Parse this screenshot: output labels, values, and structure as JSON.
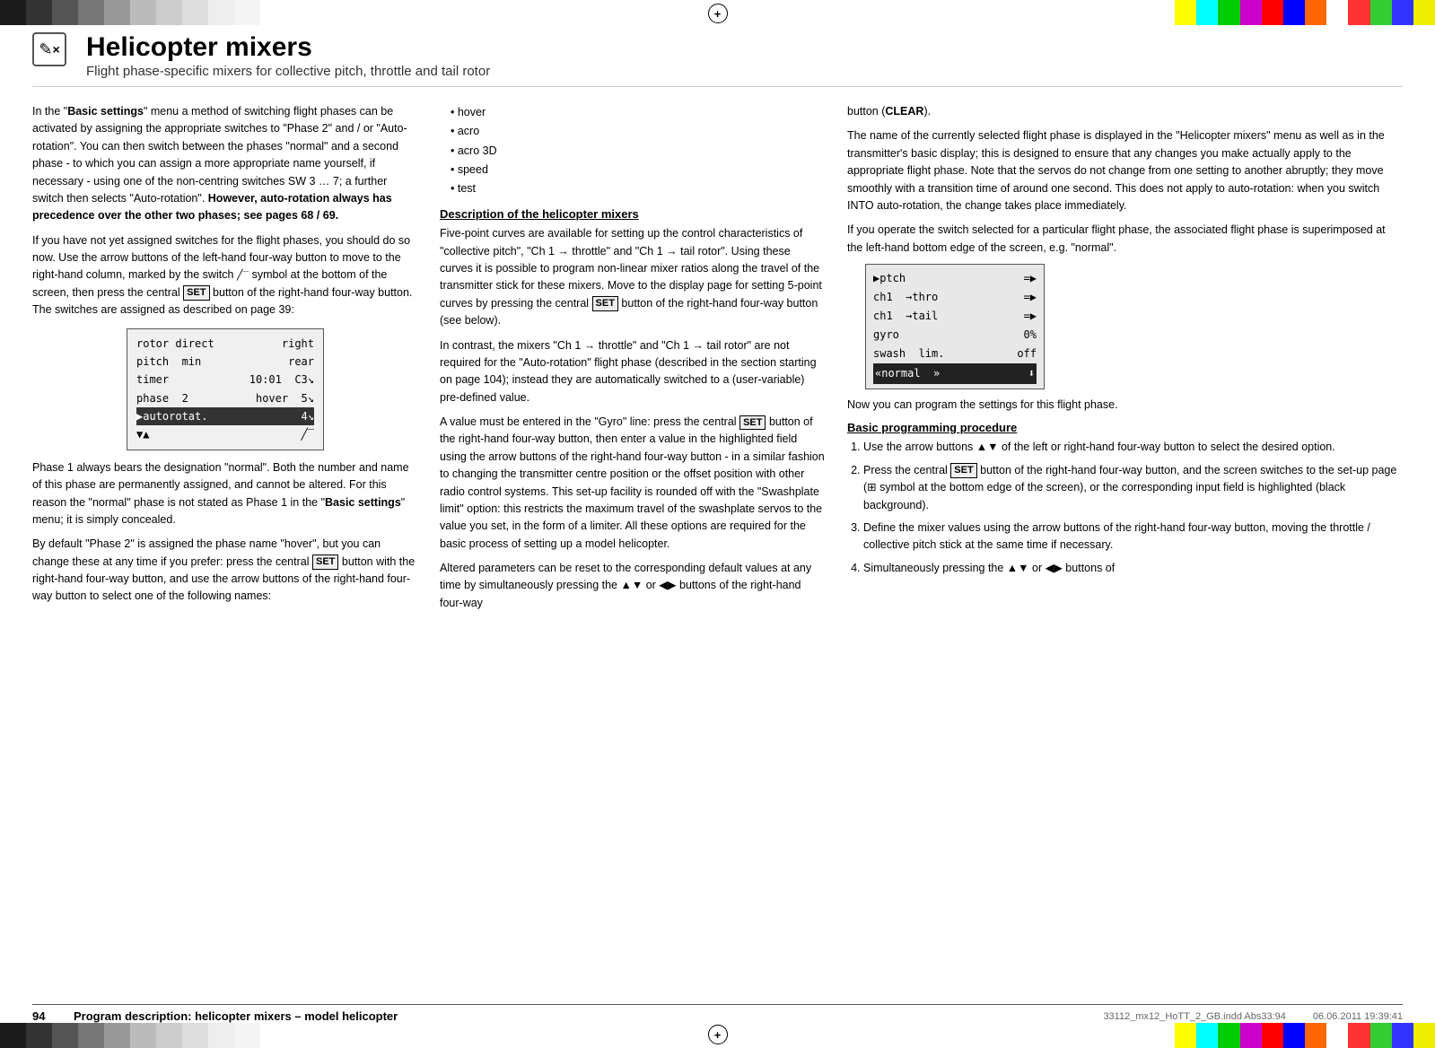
{
  "colors": {
    "left_bars": [
      "#1a1a1a",
      "#333",
      "#555",
      "#777",
      "#999",
      "#bbb",
      "#ddd",
      "#fff",
      "#fff",
      "#ddd",
      "#bbb",
      "#999"
    ],
    "right_bars": [
      "#ffff00",
      "#00ffff",
      "#00ff00",
      "#ff00ff",
      "#ff0000",
      "#0000ff",
      "#ff6600",
      "#fff",
      "#ff0000",
      "#00ff00",
      "#0000ff",
      "#ffff00"
    ]
  },
  "header": {
    "icon": "✏×",
    "title": "Helicopter mixers",
    "subtitle": "Flight phase-specific mixers for collective pitch, throttle and tail rotor"
  },
  "left_col": {
    "intro_p1": "In the \"Basic settings\" menu a method of switching flight phases can be activated by assigning the appropriate switches to \"Phase 2\" and / or \"Auto-rotation\". You can then switch between the phases \"normal\" and a second phase - to which you can assign a more appropriate name yourself, if necessary - using one of the non-centring switches SW 3 … 7; a further switch then selects \"Auto-rotation\".",
    "intro_bold": "However, auto-rotation always has precedence over the other two phases; see pages 68 / 69.",
    "intro_p2": "If you have not yet assigned switches for the flight phases, you should do so now. Use the arrow buttons of the left-hand four-way button to move to the right-hand column, marked by the switch",
    "intro_p2b": "symbol at the bottom of the screen, then press the central",
    "intro_p2c": "button of the right-hand four-way button. The switches are assigned as described on page 39:",
    "screen": {
      "rows": [
        {
          "left": "rotor direct",
          "right": "right"
        },
        {
          "left": "pitch  min",
          "right": "rear"
        },
        {
          "left": "timer",
          "mid": "10:01",
          "right": "C3↘"
        },
        {
          "left": "phase  2",
          "mid": "hover",
          "right": "5↘"
        },
        {
          "left": "▶autorotat.",
          "right": "4↘",
          "highlight": true
        },
        {
          "left": "▼▲",
          "right": "╱-"
        }
      ]
    },
    "p3": "Phase 1 always bears the designation \"normal\". Both the number and name of this phase are permanently assigned, and cannot be altered. For this reason the \"normal\" phase is not stated as Phase 1 in the \"Basic settings\" menu; it is simply concealed.",
    "p4": "By default \"Phase 2\" is assigned the phase name \"hover\", but you can change these at any time if you prefer: press the central",
    "p4b": "button with the right-hand four-way button, and use the arrow buttons of the right-hand four-way button to select one of the following names:"
  },
  "middle_col": {
    "bullet_items": [
      "hover",
      "acro",
      "acro 3D",
      "speed",
      "test"
    ],
    "section1_heading": "Description of the helicopter mixers",
    "section1_p1": "Five-point curves are available for setting up the control characteristics of \"collective pitch\", \"Ch 1 → throttle\" and \"Ch 1 → tail rotor\". Using these curves it is possible to program non-linear mixer ratios along the travel of the transmitter stick for these mixers. Move to the display page for setting 5-point curves by pressing the central",
    "section1_p1b": "button of the right-hand four-way button (see below).",
    "section1_p2": "In contrast, the mixers \"Ch 1 → throttle\" and \"Ch 1 → tail rotor\" are not required for the \"Auto-rotation\" flight phase (described in the section starting on page 104); instead they are automatically switched to a (user-variable) pre-defined value.",
    "section1_p3": "A value must be entered in the \"Gyro\" line: press the central",
    "section1_p3b": "button of the right-hand four-way button, then enter a value in the highlighted field using the arrow buttons of the right-hand four-way button - in a similar fashion to changing the transmitter centre position or the offset position with other radio control systems. This set-up facility is rounded off with the \"Swashplate limit\" option: this restricts the maximum travel of the swashplate servos to the value you set, in the form of a limiter. All these options are required for the basic process of setting up a model helicopter.",
    "section1_p4": "Altered parameters can be reset to the corresponding default values at any time by simultaneously pressing the ▲▼ or ◀▶ buttons of the right-hand four-way"
  },
  "right_col": {
    "p1": "button (CLEAR).",
    "p2": "The name of the currently selected flight phase is displayed in the \"Helicopter mixers\" menu as well as in the transmitter's basic display; this is designed to ensure that any changes you make actually apply to the appropriate flight phase. Note that the servos do not change from one setting to another abruptly; they move smoothly with a transition time of around one second. This does not apply to auto-rotation: when you switch INTO auto-rotation, the change takes place immediately.",
    "p3": "If you operate the switch selected for a particular flight phase, the associated flight phase is superimposed at the left-hand bottom edge of the screen, e.g. \"normal\".",
    "screen": {
      "rows": [
        {
          "left": "▶ptch",
          "right": "=▶"
        },
        {
          "left": "ch1  →thro",
          "right": "=▶"
        },
        {
          "left": "ch1  →tail",
          "right": "=▶"
        },
        {
          "left": "gyro",
          "mid": "0%",
          "right": ""
        },
        {
          "left": "swash  lim.",
          "mid": "off",
          "right": ""
        },
        {
          "left": "«normal  »",
          "right": "⬇",
          "selected": true
        }
      ]
    },
    "p4": "Now you can program the settings for this flight phase.",
    "section2_heading": "Basic programming procedure",
    "steps": [
      "Use the arrow buttons ▲▼ of the left or right-hand four-way button to select the desired option.",
      "Press the central SET button of the right-hand four-way button, and the screen switches to the set-up page (⊞ symbol at the bottom edge of the screen), or the corresponding input field is highlighted (black background).",
      "Define the mixer values using the arrow buttons of the right-hand four-way button, moving the throttle / collective pitch stick at the same time if necessary.",
      "Simultaneously pressing the ▲▼ or ◀▶ buttons of"
    ]
  },
  "footer": {
    "page_number": "94",
    "text": "Program description: helicopter mixers – model helicopter",
    "meta_left": "33112_mx12_HoTT_2_GB.indd   Abs33:94",
    "meta_right": "06.06.2011   19:39:41"
  }
}
